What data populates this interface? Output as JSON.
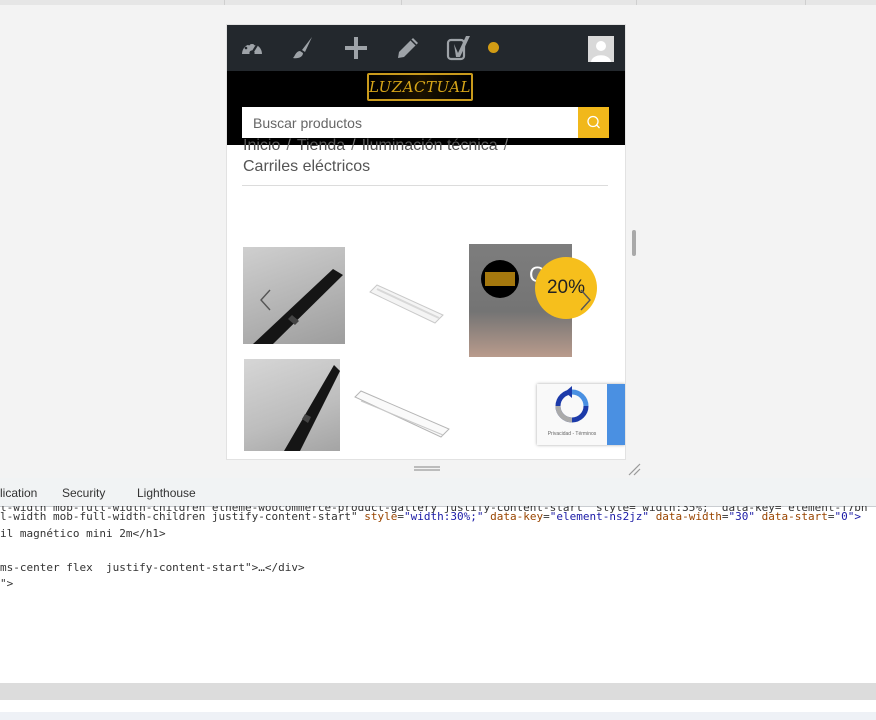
{
  "search": {
    "placeholder": "Buscar productos"
  },
  "logo": {
    "text": "LUZACTUAL"
  },
  "breadcrumb": {
    "items": [
      "Inicio",
      "Tienda",
      "Iluminación técnica"
    ],
    "current": "Carriles eléctricos",
    "separator": "/"
  },
  "gallery": {
    "sale_badge": "20%",
    "thumb3_char": "C"
  },
  "recaptcha": {
    "text": "Privacidad - Términos"
  },
  "devtools": {
    "tabs": [
      "lication",
      "Security",
      "Lighthouse"
    ],
    "code_lines": [
      {
        "text": "l-width mob-full-width-children etheme-woocommerce-product-gallery justify-content-start\" style=\"width:35%;\" data-key=\"element-f7bh"
      },
      {
        "pre": "l-width mob-full-width-children justify-content-start\" ",
        "a1": "style",
        "v1": "\"width:30%;\"",
        "a2": "data-key",
        "v2": "\"element-ns2jz\"",
        "a3": "data-width",
        "v3": "\"30\"",
        "a4": "data-start",
        "v4": "\"0\">"
      },
      {
        "text": "il magnético mini 2m</h1>"
      },
      {
        "text": ""
      },
      {
        "text": "ms-center flex  justify-content-start\">…</div>"
      },
      {
        "text": "\">"
      }
    ]
  },
  "colors": {
    "admin_bar": "#23282d",
    "header_bg": "#000000",
    "accent_yellow": "#f1b81b",
    "notification": "#d29c14",
    "recaptcha_blue": "#4a90e2"
  },
  "icons": [
    "dashboard-icon",
    "customize-brush-icon",
    "new-plus-icon",
    "edit-pencil-icon",
    "yoast-icon",
    "user-avatar-icon",
    "search-icon",
    "prev-arrow-icon",
    "next-arrow-icon",
    "recaptcha-icon"
  ]
}
